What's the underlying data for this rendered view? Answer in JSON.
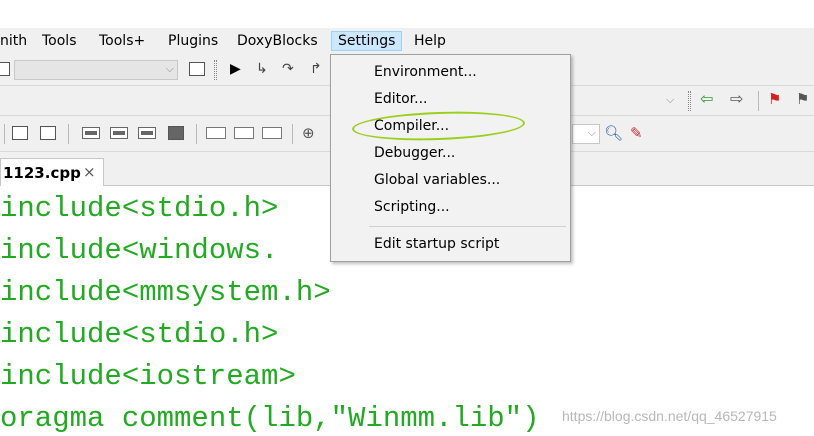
{
  "menubar": {
    "items": [
      {
        "label": "nith"
      },
      {
        "label": "Tools"
      },
      {
        "label": "Tools+"
      },
      {
        "label": "Plugins"
      },
      {
        "label": "DoxyBlocks"
      },
      {
        "label": "Settings"
      },
      {
        "label": "Help"
      }
    ]
  },
  "settings_menu": {
    "items": [
      {
        "label": "Environment..."
      },
      {
        "label": "Editor..."
      },
      {
        "label": "Compiler..."
      },
      {
        "label": "Debugger..."
      },
      {
        "label": "Global variables..."
      },
      {
        "label": "Scripting..."
      },
      {
        "label": "Edit startup script"
      }
    ]
  },
  "tab": {
    "label": "1123.cpp",
    "close": "×"
  },
  "editor": {
    "lines": [
      "include<stdio.h>",
      "include<windows.",
      "include<mmsystem.h>",
      "include<stdio.h>",
      "include<iostream>",
      "oragma comment(lib,\"Winmm.lib\")"
    ]
  },
  "watermark": "https://blog.csdn.net/qq_46527915",
  "colors": {
    "code": "#22aa22",
    "menu_active": "#cce8ff",
    "highlight_ring": "#9bcf1e"
  }
}
